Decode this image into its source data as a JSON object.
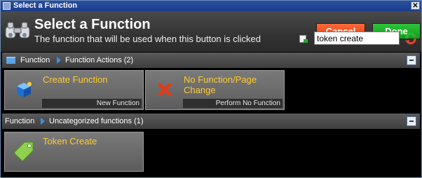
{
  "window": {
    "title": "Select a Function",
    "close_glyph": "✕"
  },
  "header": {
    "title": "Select a Function",
    "subtitle": "The function that will be used when this button is clicked",
    "cancel_label": "Cancel",
    "done_label": "Done"
  },
  "search": {
    "value": "token create"
  },
  "sections": [
    {
      "crumb_root": "Function",
      "crumb_child": "Function Actions (2)",
      "tiles": [
        {
          "label": "Create Function",
          "description": "New Function",
          "icon": "blue-cube-icon"
        },
        {
          "label": "No Function/Page Change",
          "description": "Perform No Function",
          "icon": "red-x-icon"
        }
      ]
    },
    {
      "crumb_root": "Function",
      "crumb_child": "Uncategorized functions (1)",
      "tiles": [
        {
          "label": "Token Create",
          "description": "",
          "icon": "green-tag-icon"
        }
      ]
    }
  ],
  "colors": {
    "cancel": "#e84a1e",
    "done": "#1fae2a",
    "tile_label": "#ffcb2e",
    "accent_blue": "#3d8fe0"
  }
}
